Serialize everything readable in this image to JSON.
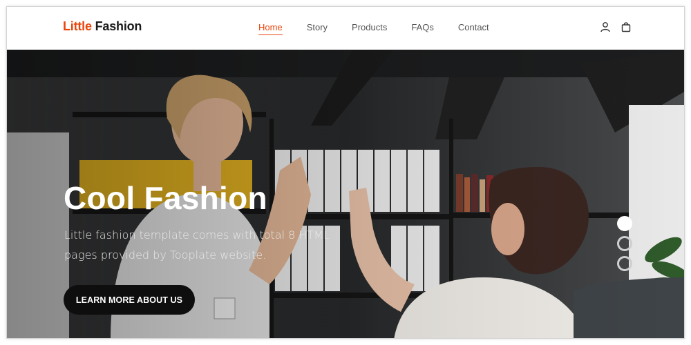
{
  "brand": {
    "part1": "Little",
    "part2": "Fashion"
  },
  "nav": {
    "items": [
      {
        "label": "Home",
        "active": true
      },
      {
        "label": "Story",
        "active": false
      },
      {
        "label": "Products",
        "active": false
      },
      {
        "label": "FAQs",
        "active": false
      },
      {
        "label": "Contact",
        "active": false
      }
    ]
  },
  "header_icons": [
    "user-icon",
    "shopping-bag-icon"
  ],
  "hero": {
    "title": "Cool Fashion",
    "text": "Little fashion template comes with total 8 HTML pages provided by Tooplate website.",
    "cta_label": "LEARN MORE ABOUT US",
    "slide_dots": 3,
    "active_slide": 1
  },
  "colors": {
    "accent": "#e8450c",
    "dark": "#0e0e0e",
    "text": "#555555"
  }
}
